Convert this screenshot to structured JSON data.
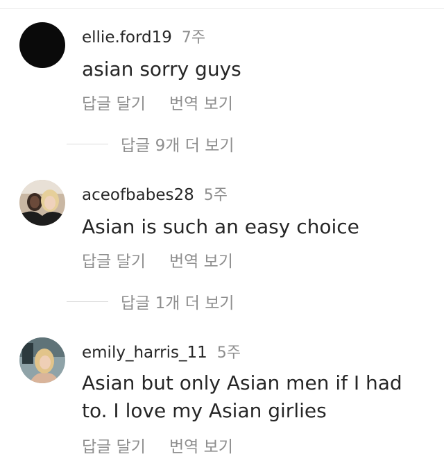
{
  "comments": [
    {
      "username": "ellie.ford19",
      "time": "7주",
      "text": "asian sorry guys",
      "reply_label": "답글 달기",
      "translate_label": "번역 보기",
      "view_replies": "답글 9개 더 보기"
    },
    {
      "username": "aceofbabes28",
      "time": "5주",
      "text": "Asian is such an easy choice",
      "reply_label": "답글 달기",
      "translate_label": "번역 보기",
      "view_replies": "답글 1개 더 보기"
    },
    {
      "username": "emily_harris_11",
      "time": "5주",
      "text": "Asian but only Asian men if I had to. I love my Asian girlies",
      "reply_label": "답글 달기",
      "translate_label": "번역 보기"
    }
  ],
  "colors": {
    "text": "#262626",
    "muted": "#8e8e8e",
    "divider": "#dbdbdb"
  }
}
